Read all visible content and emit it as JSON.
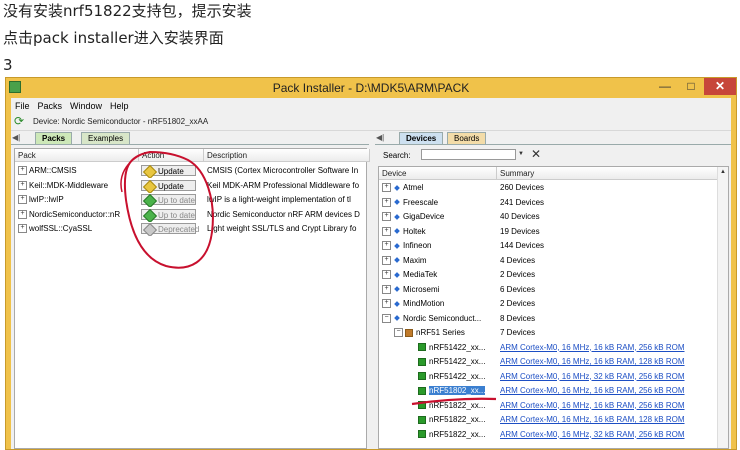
{
  "captions": [
    "没有安装nrf51822支持包，提示安装",
    "点击pack installer进入安装界面",
    "3"
  ],
  "window": {
    "title": "Pack Installer - D:\\MDK5\\ARM\\PACK",
    "minimize": "—",
    "maximize": "□",
    "close": "✕"
  },
  "menu": [
    "File",
    "Packs",
    "Window",
    "Help"
  ],
  "toolbar": {
    "device_label": "Device:  Nordic Semiconductor - nRF51802_xxAA",
    "refresh_icon": "refresh-icon"
  },
  "left_panel": {
    "tabs": [
      "Packs",
      "Examples"
    ],
    "columns": [
      "Pack",
      "Action",
      "Description"
    ],
    "rows": [
      {
        "pack": "ARM::CMSIS",
        "action": "Update",
        "status": "update",
        "description": "CMSIS (Cortex Microcontroller Software In"
      },
      {
        "pack": "Keil::MDK-Middleware",
        "action": "Update",
        "status": "update",
        "description": "Keil MDK-ARM Professional Middleware fo"
      },
      {
        "pack": "lwIP::lwIP",
        "action": "Up to date",
        "status": "uptodate",
        "description": "lwIP is a light-weight implementation of tl"
      },
      {
        "pack": "NordicSemiconductor::nR",
        "action": "Up to date",
        "status": "uptodate",
        "description": "Nordic Semiconductor nRF ARM devices D"
      },
      {
        "pack": "wolfSSL::CyaSSL",
        "action": "Deprecated",
        "status": "deprecated",
        "description": "Light weight SSL/TLS and Crypt Library fo"
      }
    ]
  },
  "right_panel": {
    "tabs": [
      "Devices",
      "Boards"
    ],
    "search": {
      "label": "Search:",
      "value": "",
      "clear": "✕"
    },
    "columns": [
      "Device",
      "Summary"
    ],
    "rows": [
      {
        "device": "Atmel",
        "summary": "260 Devices",
        "level": 0,
        "kind": "vendor",
        "expander": "+"
      },
      {
        "device": "Freescale",
        "summary": "241 Devices",
        "level": 0,
        "kind": "vendor",
        "expander": "+"
      },
      {
        "device": "GigaDevice",
        "summary": "40 Devices",
        "level": 0,
        "kind": "vendor",
        "expander": "+"
      },
      {
        "device": "Holtek",
        "summary": "19 Devices",
        "level": 0,
        "kind": "vendor",
        "expander": "+"
      },
      {
        "device": "Infineon",
        "summary": "144 Devices",
        "level": 0,
        "kind": "vendor",
        "expander": "+"
      },
      {
        "device": "Maxim",
        "summary": "4 Devices",
        "level": 0,
        "kind": "vendor",
        "expander": "+"
      },
      {
        "device": "MediaTek",
        "summary": "2 Devices",
        "level": 0,
        "kind": "vendor",
        "expander": "+"
      },
      {
        "device": "Microsemi",
        "summary": "6 Devices",
        "level": 0,
        "kind": "vendor",
        "expander": "+"
      },
      {
        "device": "MindMotion",
        "summary": "2 Devices",
        "level": 0,
        "kind": "vendor",
        "expander": "+"
      },
      {
        "device": "Nordic Semiconduct...",
        "summary": "8 Devices",
        "level": 0,
        "kind": "vendor",
        "expander": "−"
      },
      {
        "device": "nRF51 Series",
        "summary": "7 Devices",
        "level": 1,
        "kind": "series",
        "expander": "−"
      },
      {
        "device": "nRF51422_xx...",
        "summary": "ARM Cortex-M0, 16 MHz, 16 kB RAM, 256 kB ROM",
        "level": 2,
        "kind": "chip"
      },
      {
        "device": "nRF51422_xx...",
        "summary": "ARM Cortex-M0, 16 MHz, 16 kB RAM, 128 kB ROM",
        "level": 2,
        "kind": "chip"
      },
      {
        "device": "nRF51422_xx...",
        "summary": "ARM Cortex-M0, 16 MHz, 32 kB RAM, 256 kB ROM",
        "level": 2,
        "kind": "chip"
      },
      {
        "device": "nRF51802_xx...",
        "summary": "ARM Cortex-M0, 16 MHz, 16 kB RAM, 256 kB ROM",
        "level": 2,
        "kind": "chip",
        "selected": true
      },
      {
        "device": "nRF51822_xx...",
        "summary": "ARM Cortex-M0, 16 MHz, 16 kB RAM, 256 kB ROM",
        "level": 2,
        "kind": "chip"
      },
      {
        "device": "nRF51822_xx...",
        "summary": "ARM Cortex-M0, 16 MHz, 16 kB RAM, 128 kB ROM",
        "level": 2,
        "kind": "chip"
      },
      {
        "device": "nRF51822_xx...",
        "summary": "ARM Cortex-M0, 16 MHz, 32 kB RAM, 256 kB ROM",
        "level": 2,
        "kind": "chip"
      }
    ]
  },
  "colors": {
    "title_bar": "#f0c24a",
    "annotation": "#c8102e",
    "link": "#1c4ec4",
    "selection": "#3b7fd0"
  }
}
